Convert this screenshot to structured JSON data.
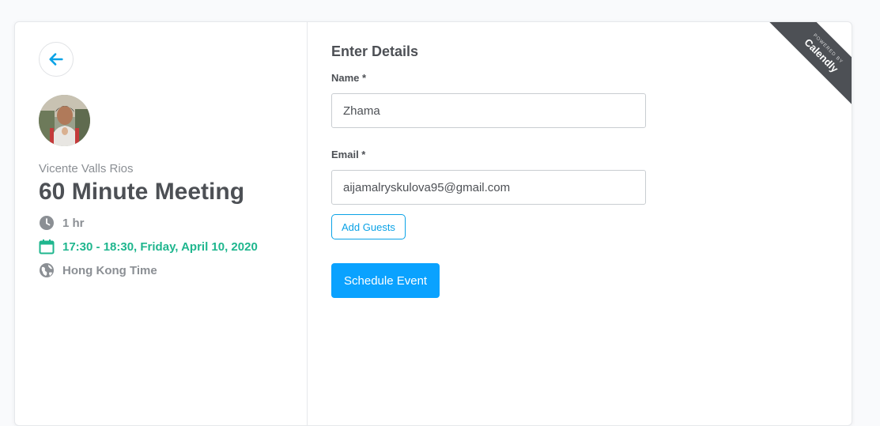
{
  "left_panel": {
    "host_name": "Vicente Valls Rios",
    "event_title": "60 Minute Meeting",
    "duration": "1 hr",
    "datetime": "17:30 - 18:30, Friday, April 10, 2020",
    "timezone": "Hong Kong Time",
    "icons": [
      "arrow-left-icon",
      "clock-icon",
      "calendar-icon",
      "globe-icon"
    ]
  },
  "form": {
    "section_title": "Enter Details",
    "name_label": "Name *",
    "name_value": "Zhama",
    "email_label": "Email *",
    "email_value": "aijamalryskulova95@gmail.com",
    "add_guests_label": "Add Guests",
    "schedule_label": "Schedule Event"
  },
  "ribbon": {
    "small_text": "POWERED BY",
    "brand": "Calendly"
  },
  "colors": {
    "accent": "#0aa2ff",
    "datetime_green": "#1fb68e",
    "text_dark": "#4d5055",
    "text_muted": "#8b8f94",
    "ribbon": "#4d5055"
  }
}
